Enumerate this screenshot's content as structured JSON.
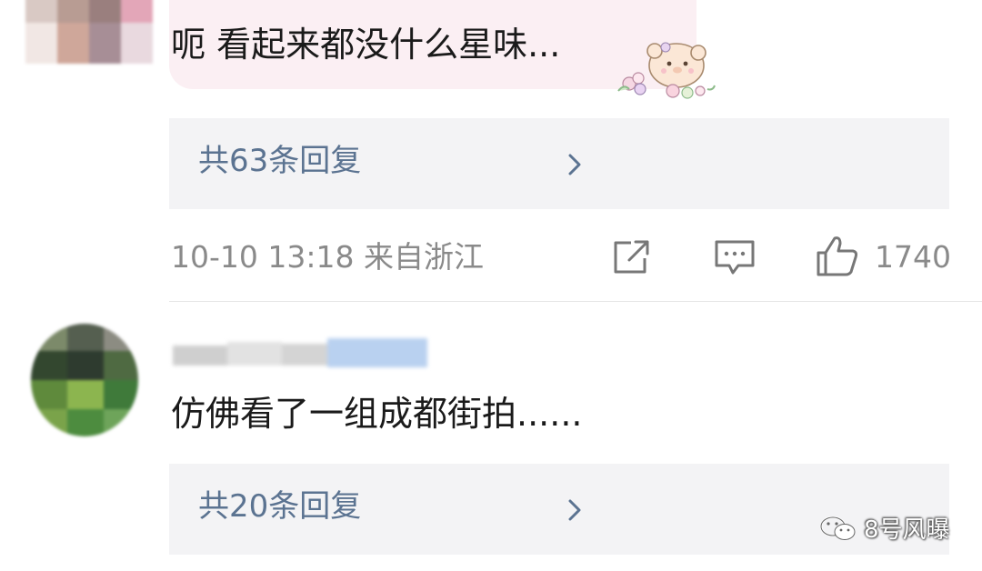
{
  "comments": [
    {
      "text": "呃 看起来都没什么星味...",
      "replies_label": "共63条回复",
      "meta": "10-10 13:18 来自浙江",
      "like_count": "1740"
    },
    {
      "text": "仿佛看了一组成都街拍......",
      "replies_label": "共20条回复"
    }
  ],
  "icons": {
    "share": "share-icon",
    "comment": "comment-icon",
    "like": "thumbs-up-icon",
    "chevron": "chevron-right-icon",
    "sticker": "bear-flower-sticker"
  },
  "watermark": {
    "text": "8号风曝"
  },
  "colors": {
    "bubble_bg": "#fbeff3",
    "reply_bg": "#f3f3f5",
    "reply_text": "#5b7391",
    "meta_text": "#8a8a8a"
  }
}
